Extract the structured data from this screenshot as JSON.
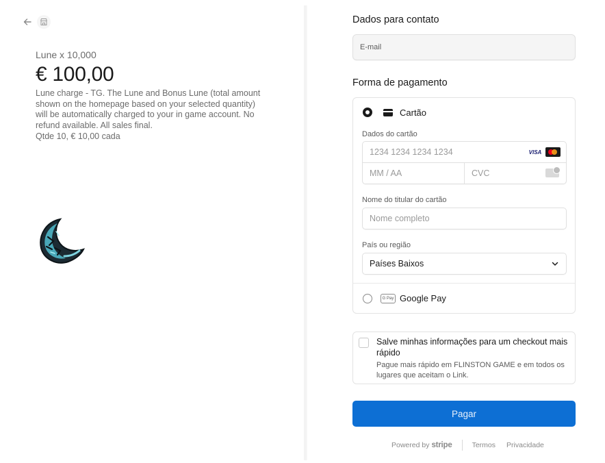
{
  "product": {
    "name": "Lune x 10,000",
    "price": "€ 100,00",
    "description": "Lune charge - TG. The Lune and Bonus Lune (total amount shown on the homepage based on your selected quantity) will be automatically charged to your in game account. No refund available. All sales final.",
    "quantity_line": "Qtde 10, € 10,00 cada"
  },
  "contact": {
    "title": "Dados para contato",
    "email_placeholder": "E-mail"
  },
  "payment": {
    "title": "Forma de pagamento",
    "card_method_label": "Cartão",
    "card_details_label": "Dados do cartão",
    "card_number_placeholder": "1234 1234 1234 1234",
    "visa_label": "VISA",
    "expiry_placeholder": "MM / AA",
    "cvc_placeholder": "CVC",
    "cardholder_label": "Nome do titular do cartão",
    "cardholder_placeholder": "Nome completo",
    "country_label": "País ou região",
    "country_value": "Países Baixos",
    "gpay_icon_text": "G Pay",
    "gpay_label": "Google Pay"
  },
  "save_info": {
    "title": "Salve minhas informações para um checkout mais rápido",
    "description": "Pague mais rápido em FLINSTON GAME e em todos os lugares que aceitam o Link."
  },
  "pay_button_label": "Pagar",
  "footer": {
    "powered_by": "Powered by",
    "brand": "stripe",
    "terms": "Termos",
    "privacy": "Privacidade"
  },
  "colors": {
    "accent": "#0d6fd4",
    "text": "#1a1a1a",
    "muted": "#6b6b6b"
  }
}
